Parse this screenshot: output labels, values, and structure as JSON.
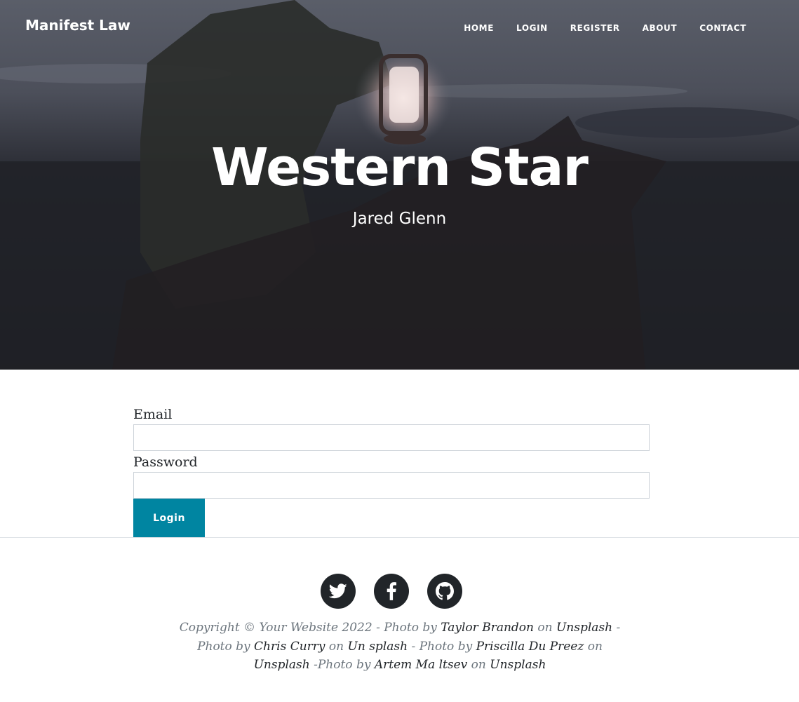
{
  "navbar": {
    "brand": "Manifest Law",
    "links": [
      "HOME",
      "LOGIN",
      "REGISTER",
      "ABOUT",
      "CONTACT"
    ]
  },
  "hero": {
    "title": "Western Star",
    "subtitle": "Jared Glenn"
  },
  "form": {
    "email_label": "Email",
    "email_value": "",
    "password_label": "Password",
    "password_value": "",
    "submit_label": "Login"
  },
  "footer": {
    "social_icons": [
      "twitter-icon",
      "facebook-icon",
      "github-icon"
    ],
    "copyright": {
      "t1": "Copyright © Your Website 2022 - Photo by ",
      "l1": "Taylor Brandon",
      "t2": " on ",
      "l2": "Unsplash",
      "t3": " - Photo by ",
      "l3": "Chris Curry",
      "t4": " on ",
      "l4": "Un splash",
      "t5": " - Photo by ",
      "l5": "Priscilla Du Preez",
      "t6": " on ",
      "l6": "Unsplash",
      "t7": " -Photo by ",
      "l7": "Artem Ma ltsev",
      "t8": " on ",
      "l8": "Unsplash"
    }
  },
  "colors": {
    "accent": "#0085a1",
    "social_bg": "#212529",
    "muted_text": "#6c757d",
    "hero_overlay": "#24252d"
  }
}
